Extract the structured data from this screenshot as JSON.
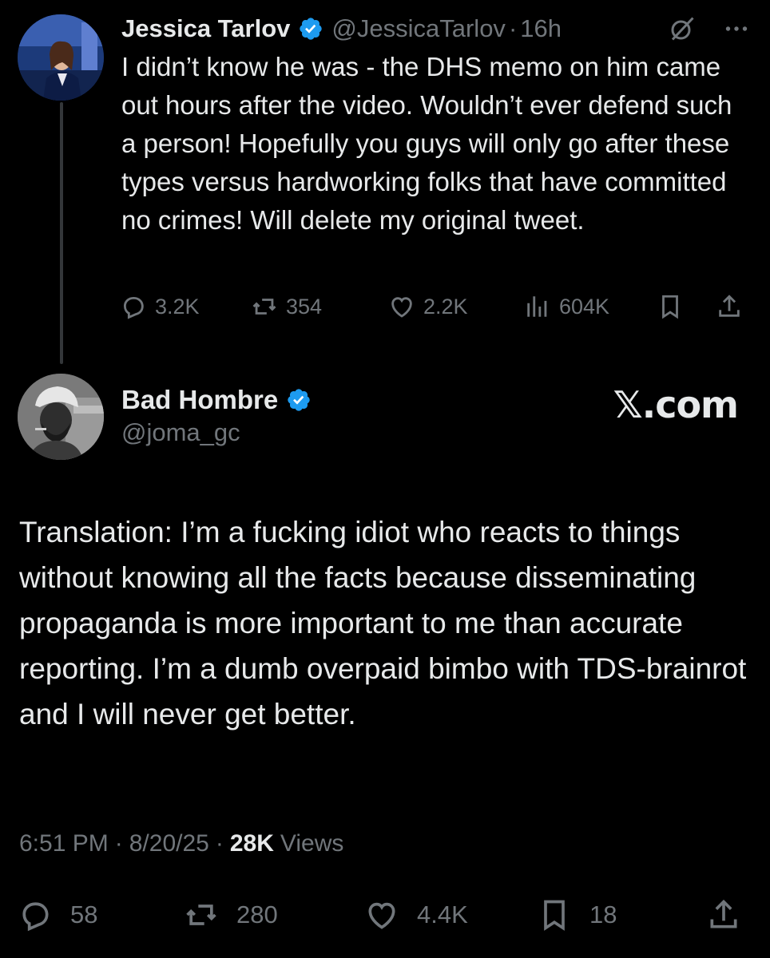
{
  "first_tweet": {
    "name": "Jessica Tarlov",
    "handle": "@JessicaTarlov",
    "separator": "·",
    "time": "16h",
    "text": "I didn’t know he was - the DHS memo on him came out hours after the video. Wouldn’t ever defend such a person! Hopefully you guys will only go after these types versus hardworking folks that have committed no crimes! Will delete my original tweet.",
    "stats": {
      "replies": "3.2K",
      "reposts": "354",
      "likes": "2.2K",
      "views": "604K"
    },
    "icons": [
      "verified-badge-icon",
      "grok-icon",
      "more-icon",
      "reply-icon",
      "repost-icon",
      "like-icon",
      "views-icon",
      "bookmark-icon",
      "share-icon"
    ]
  },
  "second_tweet": {
    "name": "Bad Hombre",
    "handle": "@joma_gc",
    "brand": "𝕏.com",
    "text": "Translation: I’m a fucking idiot who reacts to things without knowing all the facts because disseminating propaganda is more important to me than accurate reporting. I’m a dumb overpaid bimbo with TDS-brainrot and I will never get better.",
    "meta": {
      "time": "6:51 PM",
      "sep1": "·",
      "date": "8/20/25",
      "sep2": "·",
      "views_count": "28K",
      "views_label": "Views"
    },
    "stats": {
      "replies": "58",
      "reposts": "280",
      "likes": "4.4K",
      "bookmarks": "18"
    }
  },
  "colors": {
    "background": "#000000",
    "text": "#e7e9ea",
    "muted": "#71767b",
    "verified": "#1d9bf0",
    "thread_line": "#333639"
  }
}
